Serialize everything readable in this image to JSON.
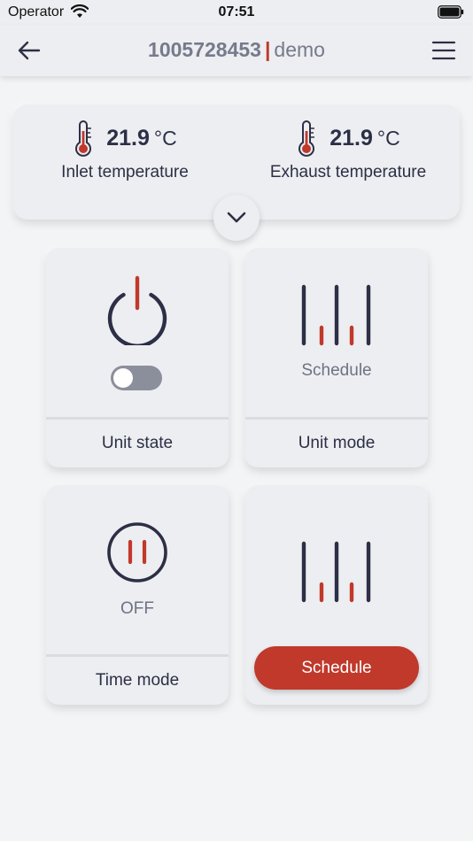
{
  "status_bar": {
    "carrier": "Operator",
    "time": "07:51"
  },
  "header": {
    "serial": "1005728453",
    "separator": "|",
    "name": "demo"
  },
  "temperatures": {
    "inlet": {
      "value": "21.9",
      "unit": "°C",
      "label": "Inlet temperature"
    },
    "exhaust": {
      "value": "21.9",
      "unit": "°C",
      "label": "Exhaust temperature"
    }
  },
  "tiles": {
    "unit_state": {
      "label": "Unit state",
      "toggle_on": false
    },
    "unit_mode": {
      "label": "Unit mode",
      "state": "Schedule"
    },
    "time_mode": {
      "label": "Time mode",
      "state": "OFF"
    },
    "schedule": {
      "button_label": "Schedule"
    }
  },
  "colors": {
    "accent": "#c0392b",
    "ink": "#2c2f45",
    "muted": "#767a8b",
    "card": "#eceef1",
    "background": "#f3f4f6"
  },
  "icons": {
    "back": "arrow-left-icon",
    "menu": "hamburger-menu-icon",
    "thermometer": "thermometer-icon",
    "expand": "chevron-down-icon",
    "power": "power-icon",
    "mode": "bars-icon",
    "pause": "pause-icon"
  }
}
